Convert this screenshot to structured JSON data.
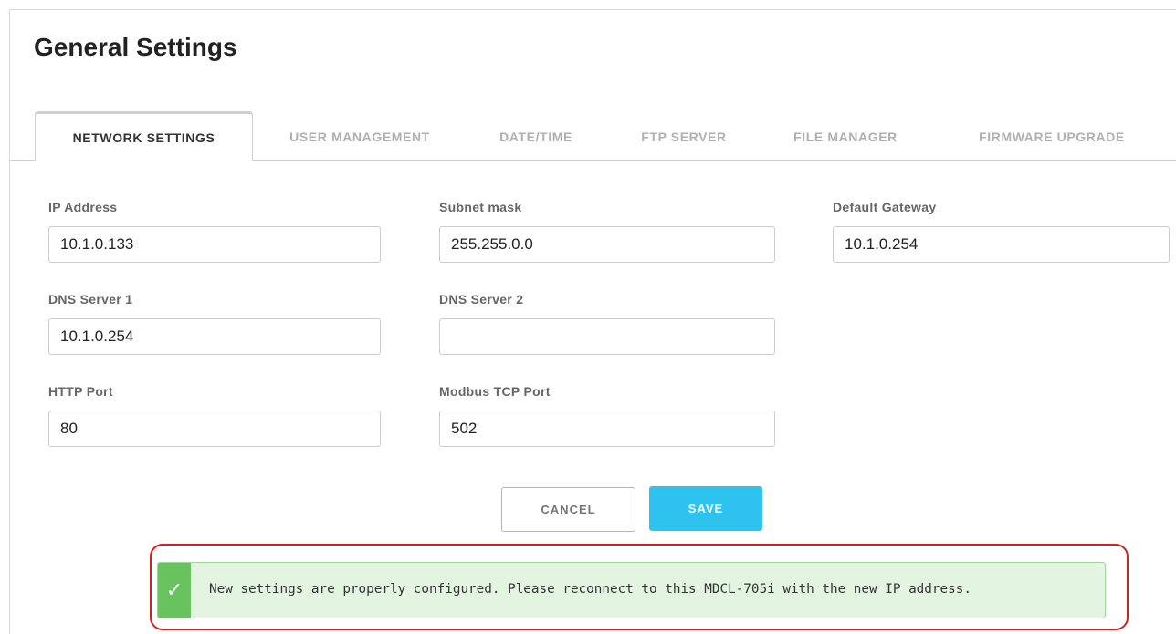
{
  "page": {
    "title": "General Settings"
  },
  "tabs": [
    {
      "label": "NETWORK SETTINGS",
      "active": true
    },
    {
      "label": "USER MANAGEMENT",
      "active": false
    },
    {
      "label": "DATE/TIME",
      "active": false
    },
    {
      "label": "FTP SERVER",
      "active": false
    },
    {
      "label": "FILE MANAGER",
      "active": false
    },
    {
      "label": "FIRMWARE UPGRADE",
      "active": false
    }
  ],
  "form": {
    "ip_address": {
      "label": "IP Address",
      "value": "10.1.0.133"
    },
    "subnet_mask": {
      "label": "Subnet mask",
      "value": "255.255.0.0"
    },
    "default_gateway": {
      "label": "Default Gateway",
      "value": "10.1.0.254"
    },
    "dns_server_1": {
      "label": "DNS Server 1",
      "value": "10.1.0.254"
    },
    "dns_server_2": {
      "label": "DNS Server 2",
      "value": ""
    },
    "http_port": {
      "label": "HTTP Port",
      "value": "80"
    },
    "modbus_tcp_port": {
      "label": "Modbus TCP Port",
      "value": "502"
    }
  },
  "actions": {
    "cancel_label": "CANCEL",
    "save_label": "SAVE"
  },
  "alert": {
    "icon": "checkmark-icon",
    "icon_glyph": "✓",
    "message": "New settings are properly configured. Please reconnect to this MDCL-705i with the new IP address."
  },
  "colors": {
    "save_button": "#2dc3ee",
    "alert_background": "#e3f5e1",
    "alert_icon": "#68c25d",
    "highlight_border": "#d62020"
  }
}
